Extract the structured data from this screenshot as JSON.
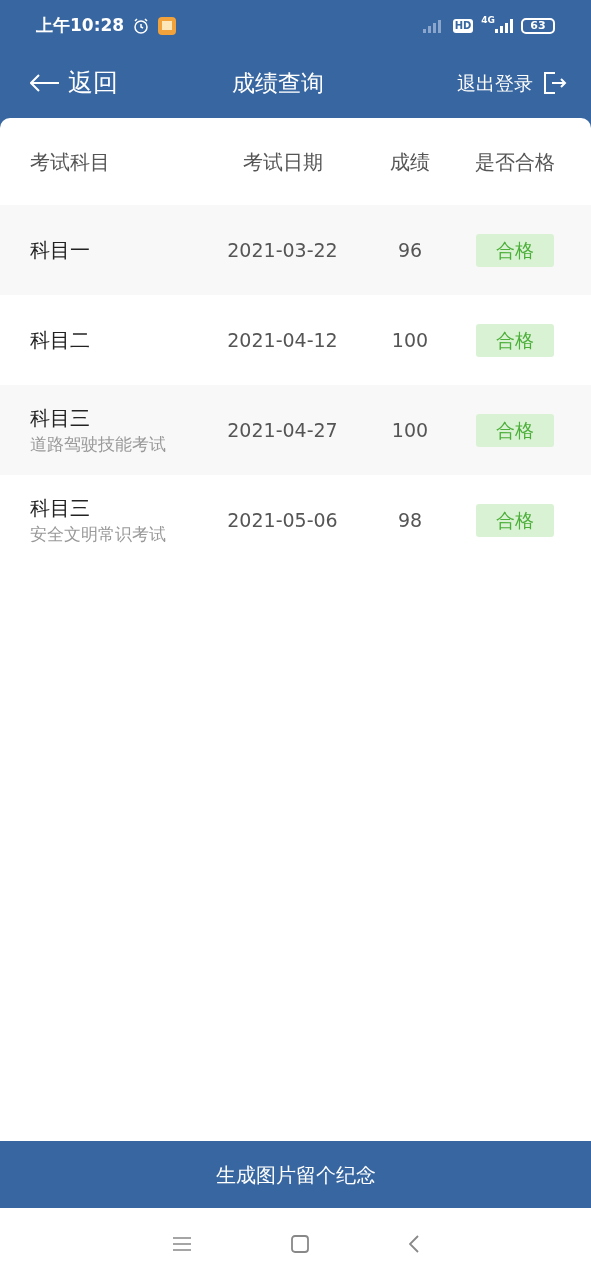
{
  "status_bar": {
    "time": "上午10:28",
    "hd": "HD",
    "network": "4G",
    "battery": "63"
  },
  "header": {
    "back": "返回",
    "title": "成绩查询",
    "logout": "退出登录"
  },
  "table": {
    "columns": [
      "考试科目",
      "考试日期",
      "成绩",
      "是否合格"
    ],
    "rows": [
      {
        "subject": "科目一",
        "date": "2021-03-22",
        "score": "96",
        "result": "合格",
        "passed": true
      },
      {
        "subject": "科目二",
        "date": "2021-04-12",
        "score": "100",
        "result": "合格",
        "passed": true
      },
      {
        "subject": "科目三",
        "subtitle": "道路驾驶技能考试",
        "date": "2021-04-27",
        "score": "100",
        "result": "合格",
        "passed": true
      },
      {
        "subject": "科目三",
        "subtitle": "安全文明常识考试",
        "date": "2021-05-06",
        "score": "98",
        "result": "合格",
        "passed": true
      }
    ]
  },
  "footer_button": "生成图片留个纪念"
}
